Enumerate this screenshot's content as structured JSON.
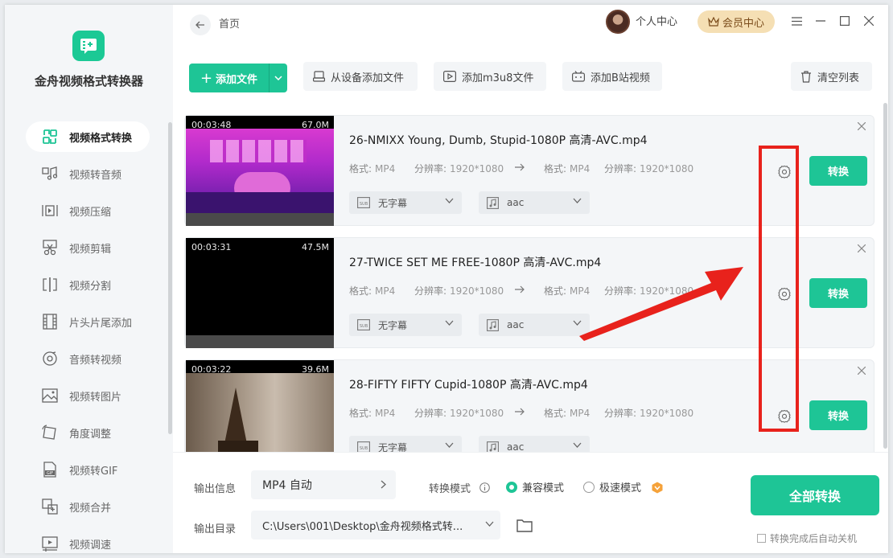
{
  "app": {
    "name": "金舟视频格式转换器"
  },
  "sidebar": {
    "items": [
      {
        "label": "视频格式转换",
        "icon": "convert-icon",
        "active": true
      },
      {
        "label": "视频转音频",
        "icon": "music-icon"
      },
      {
        "label": "视频压缩",
        "icon": "compress-icon"
      },
      {
        "label": "视频剪辑",
        "icon": "scissors-icon"
      },
      {
        "label": "视频分割",
        "icon": "split-icon"
      },
      {
        "label": "片头片尾添加",
        "icon": "film-icon"
      },
      {
        "label": "音频转视频",
        "icon": "disc-icon"
      },
      {
        "label": "视频转图片",
        "icon": "image-icon"
      },
      {
        "label": "角度调整",
        "icon": "rotate-icon"
      },
      {
        "label": "视频转GIF",
        "icon": "gif-icon"
      },
      {
        "label": "视频合并",
        "icon": "merge-icon"
      },
      {
        "label": "视频调速",
        "icon": "speed-icon"
      }
    ]
  },
  "header": {
    "breadcrumb": "首页",
    "user_center": "个人中心",
    "vip_center": "会员中心"
  },
  "toolbar": {
    "add_file": "添加文件",
    "add_from_device": "从设备添加文件",
    "add_m3u8": "添加m3u8文件",
    "add_bilibili": "添加B站视频",
    "clear_list": "清空列表"
  },
  "files": [
    {
      "name": "26-NMIXX Young, Dumb, Stupid-1080P 高清-AVC.mp4",
      "duration": "00:03:48",
      "size": "67.0M",
      "format_label": "格式:",
      "format_src": "MP4",
      "res_label": "分辨率:",
      "res_src": "1920*1080",
      "format_dst": "MP4",
      "res_dst": "1920*1080",
      "subtitle": "无字幕",
      "audio": "aac",
      "convert": "转换"
    },
    {
      "name": "27-TWICE SET ME FREE-1080P 高清-AVC.mp4",
      "duration": "00:03:31",
      "size": "47.5M",
      "format_label": "格式:",
      "format_src": "MP4",
      "res_label": "分辨率:",
      "res_src": "1920*1080",
      "format_dst": "MP4",
      "res_dst": "1920*1080",
      "subtitle": "无字幕",
      "audio": "aac",
      "convert": "转换"
    },
    {
      "name": "28-FIFTY FIFTY Cupid-1080P 高清-AVC.mp4",
      "duration": "00:03:22",
      "size": "39.6M",
      "format_label": "格式:",
      "format_src": "MP4",
      "res_label": "分辨率:",
      "res_src": "1920*1080",
      "format_dst": "MP4",
      "res_dst": "1920*1080",
      "subtitle": "无字幕",
      "audio": "aac",
      "convert": "转换"
    }
  ],
  "bottom": {
    "output_info_label": "输出信息",
    "output_format": "MP4 自动",
    "output_dir_label": "输出目录",
    "output_dir": "C:\\Users\\001\\Desktop\\金舟视频格式转...",
    "mode_label": "转换模式",
    "mode_compat": "兼容模式",
    "mode_fast": "极速模式",
    "selected_mode": "兼容模式",
    "convert_all": "全部转换",
    "auto_shutdown": "转换完成后自动关机"
  },
  "colors": {
    "accent": "#1ec596",
    "annotation": "#e8221c",
    "vip": "#f5dfb4"
  }
}
